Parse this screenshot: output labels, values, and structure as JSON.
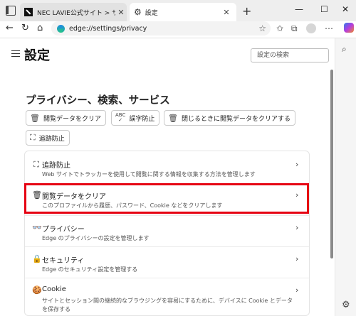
{
  "browser": {
    "tabs": [
      {
        "title": "NEC LAVIE公式サイト > サービス&サ",
        "close": "✕"
      },
      {
        "title": "設定",
        "close": "✕"
      }
    ],
    "new_tab": "+",
    "window_controls": {
      "minimize": "—",
      "maximize": "☐",
      "close": "✕"
    },
    "url": "edge://settings/privacy"
  },
  "settings": {
    "title": "設定",
    "search_placeholder": "設定の検索"
  },
  "section": {
    "title": "プライバシー、検索、サービス",
    "quick_buttons": [
      {
        "label": "閲覧データをクリア",
        "icon": "trash-icon"
      },
      {
        "label": "誤字防止",
        "icon": "abc-spell-icon"
      },
      {
        "label": "閉じるときに閲覧データをクリアする",
        "icon": "trash-clock-icon"
      },
      {
        "label": "追跡防止",
        "icon": "tracking-prevention-icon"
      }
    ]
  },
  "list": [
    {
      "title": "追跡防止",
      "desc": "Web サイトでトラッカーを使用して閲覧に関する情報を収集する方法を管理します",
      "icon": "tracking-prevention-icon"
    },
    {
      "title": "閲覧データをクリア",
      "desc": "このプロファイルから履歴、パスワード、Cookie などをクリアします",
      "icon": "trash-icon"
    },
    {
      "title": "プライバシー",
      "desc": "Edge のプライバシーの設定を管理します",
      "icon": "privacy-glasses-icon"
    },
    {
      "title": "セキュリティ",
      "desc": "Edge のセキュリティ設定を管理する",
      "icon": "lock-icon"
    },
    {
      "title": "Cookie",
      "desc": "サイトとセッション間の継続的なブラウジングを容易にするために、デバイスに Cookie とデータ",
      "desc2": "を保存する",
      "icon": "cookie-icon"
    }
  ],
  "highlight_color": "#e60012"
}
